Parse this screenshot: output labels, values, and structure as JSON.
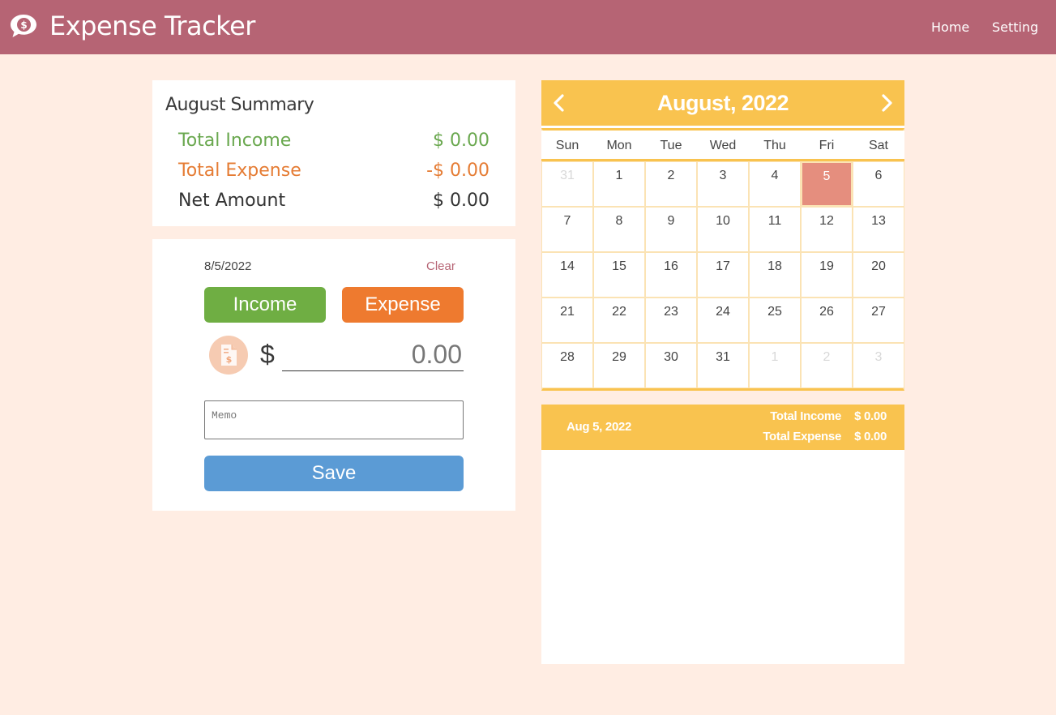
{
  "header": {
    "title": "Expense Tracker",
    "logo_icon": "dollar-speech-bubble-icon",
    "nav": {
      "home": "Home",
      "setting": "Setting"
    },
    "color": "#b66474"
  },
  "summary": {
    "title": "August Summary",
    "income_label": "Total Income",
    "income_value": "$ 0.00",
    "expense_label": "Total Expense",
    "expense_value": "-$ 0.00",
    "net_label": "Net Amount",
    "net_value": "$ 0.00"
  },
  "entry": {
    "date": "8/5/2022",
    "clear_label": "Clear",
    "income_button": "Income",
    "expense_button": "Expense",
    "receipt_icon": "receipt-icon",
    "currency": "$",
    "amount_placeholder": "0.00",
    "memo_placeholder": "Memo",
    "save_button": "Save"
  },
  "calendar": {
    "month_label": "August, 2022",
    "weekdays": [
      "Sun",
      "Mon",
      "Tue",
      "Wed",
      "Thu",
      "Fri",
      "Sat"
    ],
    "days": [
      {
        "d": "31",
        "other": true
      },
      {
        "d": "1"
      },
      {
        "d": "2"
      },
      {
        "d": "3"
      },
      {
        "d": "4"
      },
      {
        "d": "5",
        "selected": true
      },
      {
        "d": "6"
      },
      {
        "d": "7"
      },
      {
        "d": "8"
      },
      {
        "d": "9"
      },
      {
        "d": "10"
      },
      {
        "d": "11"
      },
      {
        "d": "12"
      },
      {
        "d": "13"
      },
      {
        "d": "14"
      },
      {
        "d": "15"
      },
      {
        "d": "16"
      },
      {
        "d": "17"
      },
      {
        "d": "18"
      },
      {
        "d": "19"
      },
      {
        "d": "20"
      },
      {
        "d": "21"
      },
      {
        "d": "22"
      },
      {
        "d": "23"
      },
      {
        "d": "24"
      },
      {
        "d": "25"
      },
      {
        "d": "26"
      },
      {
        "d": "27"
      },
      {
        "d": "28"
      },
      {
        "d": "29"
      },
      {
        "d": "30"
      },
      {
        "d": "31"
      },
      {
        "d": "1",
        "other": true
      },
      {
        "d": "2",
        "other": true
      },
      {
        "d": "3",
        "other": true
      }
    ],
    "accent": "#f9c34f",
    "selected_color": "#e58e7e"
  },
  "day_panel": {
    "date": "Aug 5, 2022",
    "income_label": "Total Income",
    "income_value": "$ 0.00",
    "expense_label": "Total Expense",
    "expense_value": "$ 0.00"
  }
}
